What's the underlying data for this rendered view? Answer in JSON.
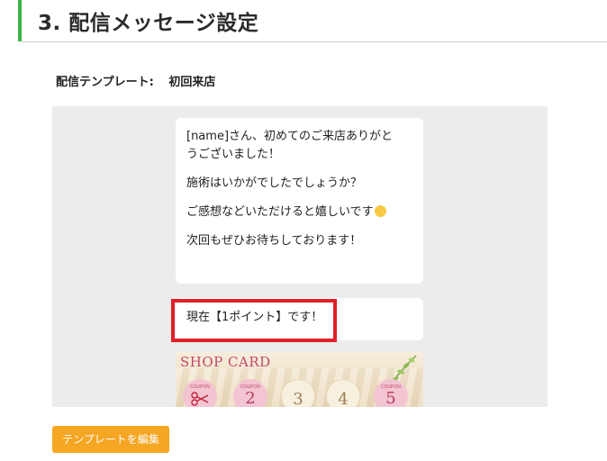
{
  "section": {
    "title": "3. 配信メッセージ設定",
    "accent_color": "#3cb44a"
  },
  "template": {
    "label": "配信テンプレート:",
    "value": "初回来店"
  },
  "message1": {
    "lines": [
      "[name]さん、初めてのご来店ありがと",
      "うございました！",
      "施術はいかがでしたでしょうか？",
      "ご感想などいただけると嬉しいです",
      "次回もぜひお待ちしております！"
    ],
    "emoji_icon": "smiling-face-icon"
  },
  "message2": {
    "text": "現在【1ポイント】です！"
  },
  "shop_card": {
    "title": "SHOP CARD",
    "coupon_label": "COUPON",
    "numbers": [
      "2",
      "3",
      "4",
      "5"
    ],
    "first_icon": "scissors-icon"
  },
  "highlight_color": "#e0202a",
  "edit_button": {
    "label": "テンプレートを編集",
    "color": "#f5a623"
  }
}
